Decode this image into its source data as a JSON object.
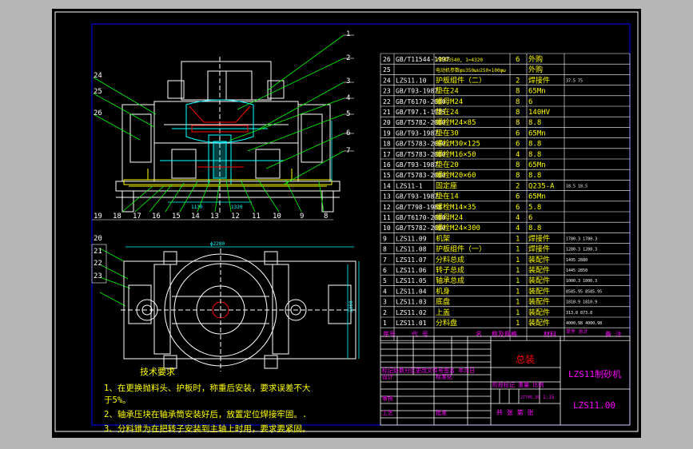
{
  "colors": {
    "frame": "#ffffff",
    "border": "#0000ff",
    "leader": "#00ff00",
    "text": "#ffff00",
    "table": "#00ffff",
    "label": "#ff00ff",
    "part": "#ff0000",
    "body": "#ffffff"
  },
  "callouts_right": [
    "1",
    "2",
    "3",
    "4",
    "5",
    "6",
    "7"
  ],
  "callouts_left": [
    "24",
    "25",
    "26"
  ],
  "bottom_labels": [
    "19",
    "18",
    "17",
    "16",
    "15",
    "14",
    "13",
    "12",
    "11",
    "10",
    "9",
    "8"
  ],
  "plan_labels": [
    "20",
    "21",
    "22",
    "23"
  ],
  "dims": {
    "d1": "1130",
    "d2": "1320",
    "d3": "ϕ2280",
    "d4": "2350"
  },
  "bom": [
    {
      "no": "26",
      "code": "GB/T11544-1997",
      "name": "V带带3540, 1=4320",
      "qty": "6",
      "note": "外购"
    },
    {
      "no": "25",
      "code": "",
      "name": "电动机参数φυ350ωυ250×100φω",
      "qty": "",
      "note": "外购"
    },
    {
      "no": "24",
      "code": "LZS11.10",
      "name": "护板组件（二）",
      "qty": "2",
      "note": "焊接件",
      "extra": "37.5   75"
    },
    {
      "no": "23",
      "code": "GB/T93-1987",
      "name": "垫在24",
      "qty": "8",
      "note": "65Mn"
    },
    {
      "no": "22",
      "code": "GB/T6170-2000",
      "name": "螺母M24",
      "qty": "8",
      "note": "6"
    },
    {
      "no": "21",
      "code": "GB/T97.1-1985",
      "name": "垫在24",
      "qty": "8",
      "note": "140HV"
    },
    {
      "no": "20",
      "code": "GB/T5782-2000",
      "name": "螺栓M24×85",
      "qty": "8",
      "note": "8.8"
    },
    {
      "no": "19",
      "code": "GB/T93-1987",
      "name": "垫在30",
      "qty": "6",
      "note": "65Mn"
    },
    {
      "no": "18",
      "code": "GB/T5783-2000",
      "name": "螺栓M30×125",
      "qty": "6",
      "note": "8.8"
    },
    {
      "no": "17",
      "code": "GB/T5783-2000",
      "name": "螺栓M16×50",
      "qty": "4",
      "note": "8.8"
    },
    {
      "no": "16",
      "code": "GB/T93-1987",
      "name": "垫在20",
      "qty": "8",
      "note": "65Mn"
    },
    {
      "no": "15",
      "code": "GB/T5783-2000",
      "name": "螺栓M20×60",
      "qty": "8",
      "note": "8.8"
    },
    {
      "no": "14",
      "code": "LZS11-1",
      "name": "固定座",
      "qty": "2",
      "note": "Q235-A",
      "extra": "18.5   18.5"
    },
    {
      "no": "13",
      "code": "GB/T93-1987",
      "name": "垫在14",
      "qty": "6",
      "note": "65Mn"
    },
    {
      "no": "12",
      "code": "GB/T798-1988",
      "name": "螺栓M14×35",
      "qty": "6",
      "note": "5.8"
    },
    {
      "no": "11",
      "code": "GB/T6170-2000",
      "name": "螺母M24",
      "qty": "4",
      "note": "6"
    },
    {
      "no": "10",
      "code": "GB/T5782-2000",
      "name": "螺栓M24×300",
      "qty": "4",
      "note": "8.8"
    },
    {
      "no": "9",
      "code": "LZS11.09",
      "name": "机架",
      "qty": "1",
      "note": "焊接件",
      "extra": "1780.3  1780.3"
    },
    {
      "no": "8",
      "code": "LZS11.08",
      "name": "护板组件（一）",
      "qty": "1",
      "note": "焊接件",
      "extra": "1280.3  1280.3"
    },
    {
      "no": "7",
      "code": "LZS11.07",
      "name": "分料总成",
      "qty": "1",
      "note": "装配件",
      "extra": "1495   2880"
    },
    {
      "no": "6",
      "code": "LZS11.06",
      "name": "转子总成",
      "qty": "1",
      "note": "装配件",
      "extra": "1445   2850"
    },
    {
      "no": "5",
      "code": "LZS11.05",
      "name": "轴承总成",
      "qty": "1",
      "note": "装配件",
      "extra": "1000.3  1000.3"
    },
    {
      "no": "4",
      "code": "LZS11.04",
      "name": "机身",
      "qty": "1",
      "note": "装配件",
      "extra": "8585.95  8585.95"
    },
    {
      "no": "3",
      "code": "LZS11.03",
      "name": "底盘",
      "qty": "1",
      "note": "装配件",
      "extra": "1810.9  1810.9"
    },
    {
      "no": "2",
      "code": "LZS11.02",
      "name": "上盖",
      "qty": "1",
      "note": "装配件",
      "extra": "313.8   873.8"
    },
    {
      "no": "1",
      "code": "LZS11.01",
      "name": "分料盘",
      "qty": "1",
      "note": "装配件",
      "extra": "4000.98  4000.98"
    }
  ],
  "bom_header": {
    "no": "序号",
    "code": "代   号",
    "name": "名",
    "spec": "称及规格",
    "mat": "材料",
    "weight": "单件 总计",
    "note": "备  注"
  },
  "title_block": {
    "assembly": "总装",
    "product": "LZS11制砂机",
    "drawing_no": "LZS11.00",
    "revision_row": "标记处数分区更改文件号签名 年月日",
    "design": "设计",
    "standardize": "标准化",
    "review": "审核",
    "process": "工艺",
    "approve": "批准",
    "stage_mark": "阶段标记 重量 比例",
    "weight": "27745.39",
    "scale": "1:15",
    "sheets": "共  张  第  张"
  },
  "tech_req": {
    "title": "技术要求",
    "items": [
      "1、在更换抛料头、护板时，称重后安装，要求误差不大",
      "于5%。",
      "2、轴承压块在轴承筒安装好后，放置定位焊接牢固。.",
      "3、分料锥为在把转子安装到主轴上时用，要求要紧固。"
    ]
  }
}
